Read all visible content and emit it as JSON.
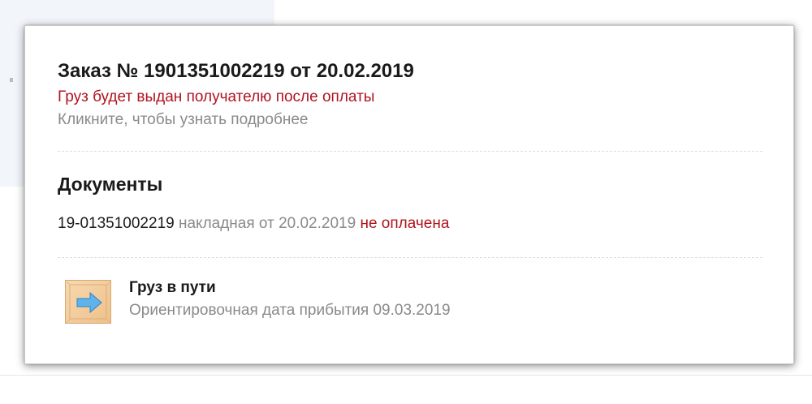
{
  "order": {
    "title": "Заказ № 1901351002219 от 20.02.2019",
    "status": "Груз будет выдан получателю после оплаты",
    "hint": "Кликните, чтобы узнать подробнее"
  },
  "documents": {
    "heading": "Документы",
    "items": [
      {
        "number": "19-01351002219",
        "description": "накладная от 20.02.2019",
        "payment_status": "не оплачена"
      }
    ]
  },
  "shipment": {
    "icon": "box-arrow-icon",
    "status": "Груз в пути",
    "eta": "Ориентировочная дата прибытия 09.03.2019"
  },
  "colors": {
    "alert": "#b0141e",
    "muted": "#8a8a8a",
    "text": "#1a1a1a"
  }
}
